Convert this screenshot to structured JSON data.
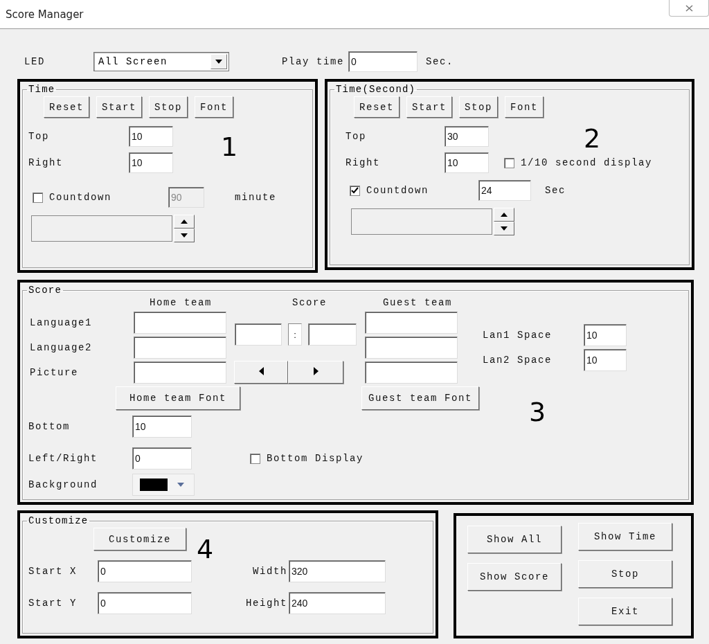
{
  "window": {
    "title": "Score Manager"
  },
  "led": {
    "label": "LED",
    "value": "All Screen"
  },
  "play_time": {
    "label": "Play time",
    "value": "0",
    "unit": "Sec."
  },
  "time_panel": {
    "annotation": "1",
    "legend": "Time",
    "buttons": [
      "Reset",
      "Start",
      "Stop",
      "Font"
    ],
    "fields": [
      {
        "label": "Top",
        "value": "10"
      },
      {
        "label": "Right",
        "value": "10"
      }
    ],
    "countdown": {
      "label": "Countdown",
      "checked": false,
      "value": "90",
      "disabled": true,
      "unit": "minute"
    }
  },
  "time_second_panel": {
    "annotation": "2",
    "legend": "Time(Second)",
    "buttons": [
      "Reset",
      "Start",
      "Stop",
      "Font"
    ],
    "fields": [
      {
        "label": "Top",
        "value": "30"
      },
      {
        "label": "Right",
        "value": "10",
        "option": {
          "label": "1/10 second display",
          "checked": false
        }
      }
    ],
    "countdown": {
      "label": "Countdown",
      "checked": true,
      "value": "24",
      "disabled": false,
      "unit": "Sec"
    }
  },
  "score_panel": {
    "annotation": "3",
    "legend": "Score",
    "headers": [
      "Home team",
      "Score",
      "Guest team"
    ],
    "rows": [
      {
        "label": "Language1"
      },
      {
        "label": "Language2"
      },
      {
        "label": "Picture"
      }
    ],
    "separator": ":",
    "font_buttons": [
      "Home team Font",
      "Guest team Font"
    ],
    "spaces": [
      {
        "label": "Lan1 Space",
        "value": "10"
      },
      {
        "label": "Lan2 Space",
        "value": "10"
      }
    ],
    "fields": [
      {
        "label": "Bottom",
        "value": "10"
      },
      {
        "label": "Left/Right",
        "value": "0"
      }
    ],
    "bottom_display": {
      "label": "Bottom Display",
      "checked": false
    },
    "background": {
      "label": "Background",
      "color": "#000000"
    }
  },
  "customize_panel": {
    "annotation": "4",
    "legend": "Customize",
    "button": "Customize",
    "fields": [
      {
        "label": "Start X",
        "value": "0"
      },
      {
        "label": "Width",
        "value": "320"
      },
      {
        "label": "Start Y",
        "value": "0"
      },
      {
        "label": "Height",
        "value": "240"
      }
    ]
  },
  "actions": {
    "columns": [
      [
        "Show All",
        "Show Score"
      ],
      [
        "Show Time",
        "Stop",
        "Exit"
      ]
    ]
  }
}
